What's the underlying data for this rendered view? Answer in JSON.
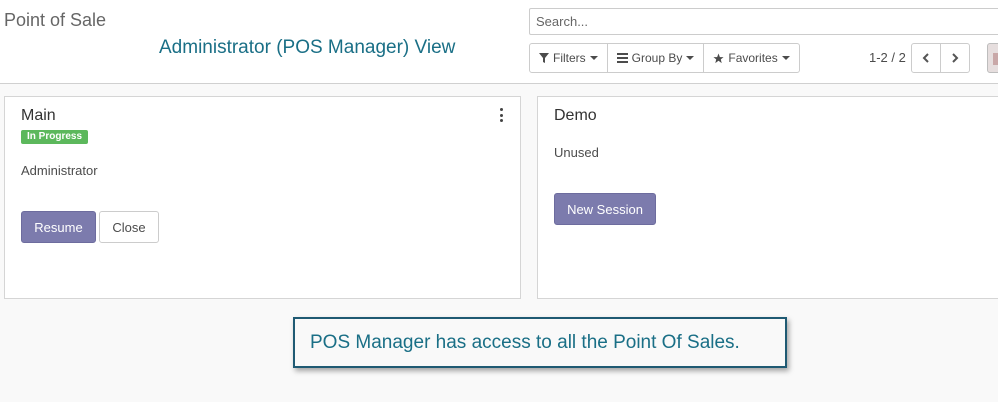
{
  "header": {
    "breadcrumb": "Point of Sale",
    "overlay_title": "Administrator (POS Manager) View"
  },
  "search": {
    "placeholder": "Search...",
    "value": ""
  },
  "filters": {
    "filters_label": "Filters",
    "group_by_label": "Group By",
    "favorites_label": "Favorites"
  },
  "pager": {
    "value": "1-2 / 2"
  },
  "cards": [
    {
      "title": "Main",
      "status": "In Progress",
      "user": "Administrator",
      "primary_button": "Resume",
      "secondary_button": "Close"
    },
    {
      "title": "Demo",
      "status_text": "Unused",
      "primary_button": "New Session"
    }
  ],
  "callout": {
    "text": "POS Manager has access to all the Point Of Sales."
  },
  "colors": {
    "accent": "#7c7bad",
    "annotation": "#1a6f86",
    "badge_success": "#5cb85c"
  },
  "icons": [
    "filter-icon",
    "list-icon",
    "star-icon",
    "chevron-left-icon",
    "chevron-right-icon",
    "kebab-menu-icon"
  ]
}
